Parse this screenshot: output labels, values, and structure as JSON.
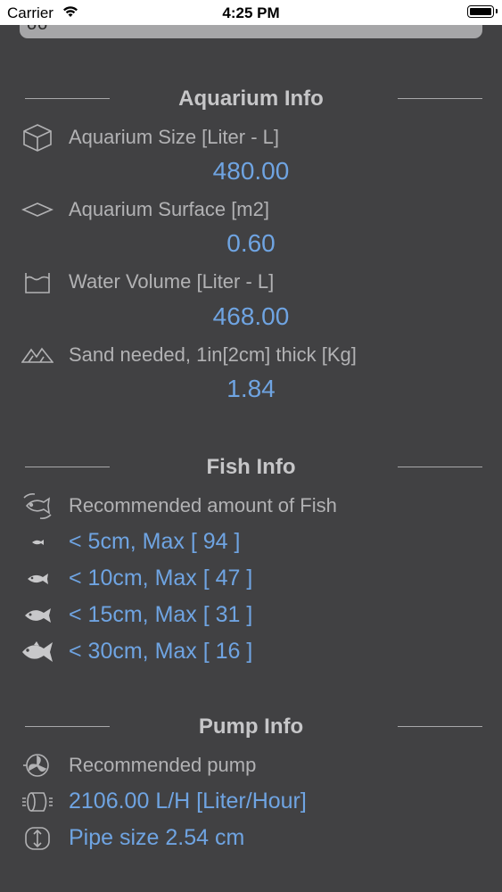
{
  "status_bar": {
    "carrier": "Carrier",
    "time": "4:25 PM"
  },
  "top_panel": {
    "glyph": "oo"
  },
  "aquarium_info": {
    "title": "Aquarium Info",
    "items": [
      {
        "label": "Aquarium Size [Liter - L]",
        "value": "480.00",
        "icon": "cube-icon"
      },
      {
        "label": "Aquarium Surface [m2]",
        "value": "0.60",
        "icon": "surface-icon"
      },
      {
        "label": "Water Volume [Liter - L]",
        "value": "468.00",
        "icon": "water-tank-icon"
      },
      {
        "label": "Sand needed, 1in[2cm] thick [Kg]",
        "value": "1.84",
        "icon": "sand-icon"
      }
    ]
  },
  "fish_info": {
    "title": "Fish Info",
    "header": "Recommended amount of Fish",
    "items": [
      {
        "label": "< 5cm, Max [ 94 ]",
        "icon": "fish-small-icon"
      },
      {
        "label": "< 10cm, Max [ 47 ]",
        "icon": "fish-medium-icon"
      },
      {
        "label": "< 15cm, Max [ 31 ]",
        "icon": "fish-large-icon"
      },
      {
        "label": "< 30cm, Max [ 16 ]",
        "icon": "fish-xlarge-icon"
      }
    ]
  },
  "pump_info": {
    "title": "Pump Info",
    "header": "Recommended pump",
    "flow": "2106.00 L/H [Liter/Hour]",
    "pipe": "Pipe size 2.54 cm"
  },
  "colors": {
    "background": "#414143",
    "label": "#b2b2b4",
    "value": "#6fa4e2"
  }
}
